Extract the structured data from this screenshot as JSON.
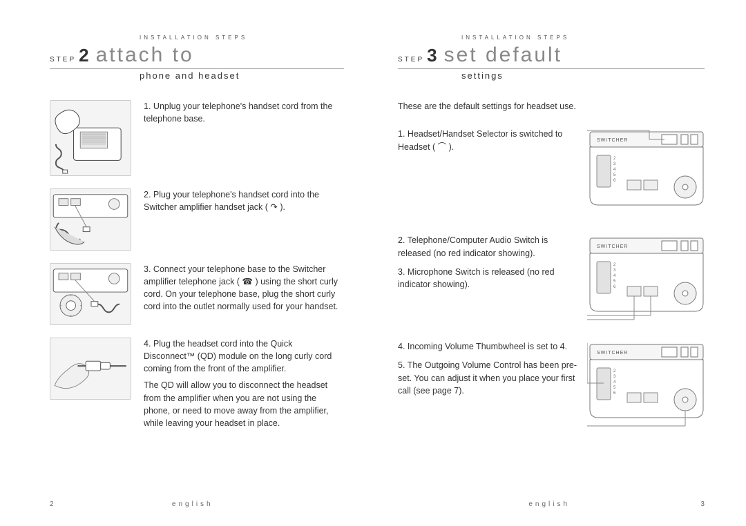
{
  "sectionLabel": "INSTALLATION STEPS",
  "left": {
    "stepWord": "STEP",
    "stepNum": "2",
    "title": "attach to",
    "subtitle": "phone and headset",
    "items": [
      {
        "n": "1.",
        "text": "Unplug your telephone's handset cord from the telephone base."
      },
      {
        "n": "2.",
        "text": "Plug your telephone's handset cord into the Switcher amplifier handset jack ( ↷ )."
      },
      {
        "n": "3.",
        "text": "Connect your telephone base to the Switcher amplifier telephone jack ( ☎ ) using the short curly cord. On your telephone base, plug the short curly cord into the outlet normally used for your handset."
      },
      {
        "n": "4.",
        "text": "Plug the headset cord into the Quick Disconnect™ (QD) module on the long curly cord coming from the front of the amplifier."
      },
      {
        "extra": "The QD will allow you to disconnect the headset from the amplifier when you are not using the phone, or need to move away from the amplifier, while leaving your headset in place."
      }
    ],
    "pageNum": "2"
  },
  "right": {
    "stepWord": "STEP",
    "stepNum": "3",
    "title": "set default",
    "subtitle": "settings",
    "intro": "These are the default settings for headset use.",
    "block1": [
      {
        "n": "1.",
        "text": "Headset/Handset Selector is switched to Headset ( ⌒ )."
      }
    ],
    "block2": [
      {
        "n": "2.",
        "text": "Telephone/Computer Audio Switch is released (no red indicator showing)."
      },
      {
        "n": "3.",
        "text": "Microphone Switch is released (no red indicator showing)."
      }
    ],
    "block3": [
      {
        "n": "4.",
        "text": "Incoming Volume Thumbwheel is set to 4."
      },
      {
        "n": "5.",
        "text": "The Outgoing Volume Control has been pre-set. You can adjust it when you place your first call (see page 7)."
      }
    ],
    "pageNum": "3"
  },
  "lang": "english"
}
